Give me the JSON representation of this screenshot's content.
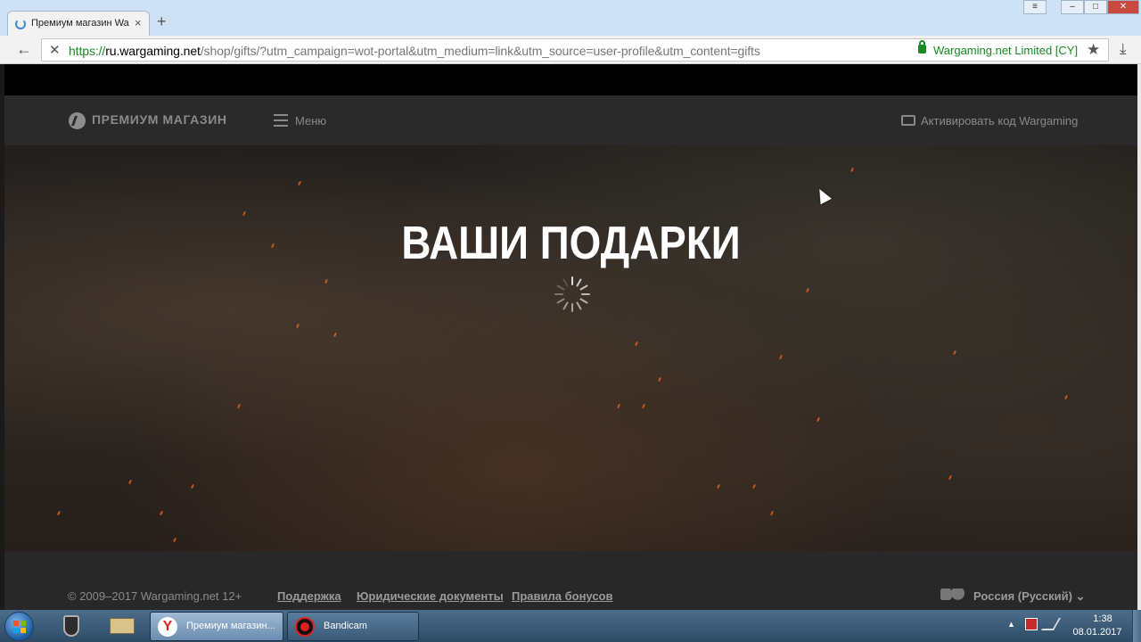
{
  "browser": {
    "tab_title": "Премиум магазин Wa",
    "tab_close": "×",
    "new_tab": "+",
    "url_scheme": "https://",
    "url_host": "ru.wargaming.net",
    "url_path": "/shop/gifts/?utm_campaign=wot-portal&utm_medium=link&utm_source=user-profile&utm_content=gifts",
    "cert_label": "Wargaming.net Limited [CY]",
    "icons": [
      "spinner-icon",
      "back-arrow-icon",
      "stop-icon",
      "lock-icon",
      "star-icon",
      "download-icon",
      "menu-icon",
      "minimize-icon",
      "maximize-icon",
      "close-icon"
    ]
  },
  "nav": {
    "logo_text": "ПРЕМИУМ МАГАЗИН",
    "menu_label": "Меню",
    "activate_label": "Активировать код Wargaming"
  },
  "hero": {
    "title": "ВАШИ ПОДАРКИ"
  },
  "footer": {
    "copyright": "© 2009–2017 Wargaming.net 12+",
    "links": [
      "Поддержка",
      "Юридические документы",
      "Правила бонусов"
    ],
    "region": "Россия (Русский)"
  },
  "taskbar": {
    "tasks": [
      {
        "label": "Премиум магазин..."
      },
      {
        "label": "Bandicam"
      }
    ],
    "time": "1:38",
    "date": "08.01.2017"
  },
  "colors": {
    "accent_green": "#1a8a25",
    "nav_bg": "#2a2a2a",
    "spark": "#e0611f"
  }
}
